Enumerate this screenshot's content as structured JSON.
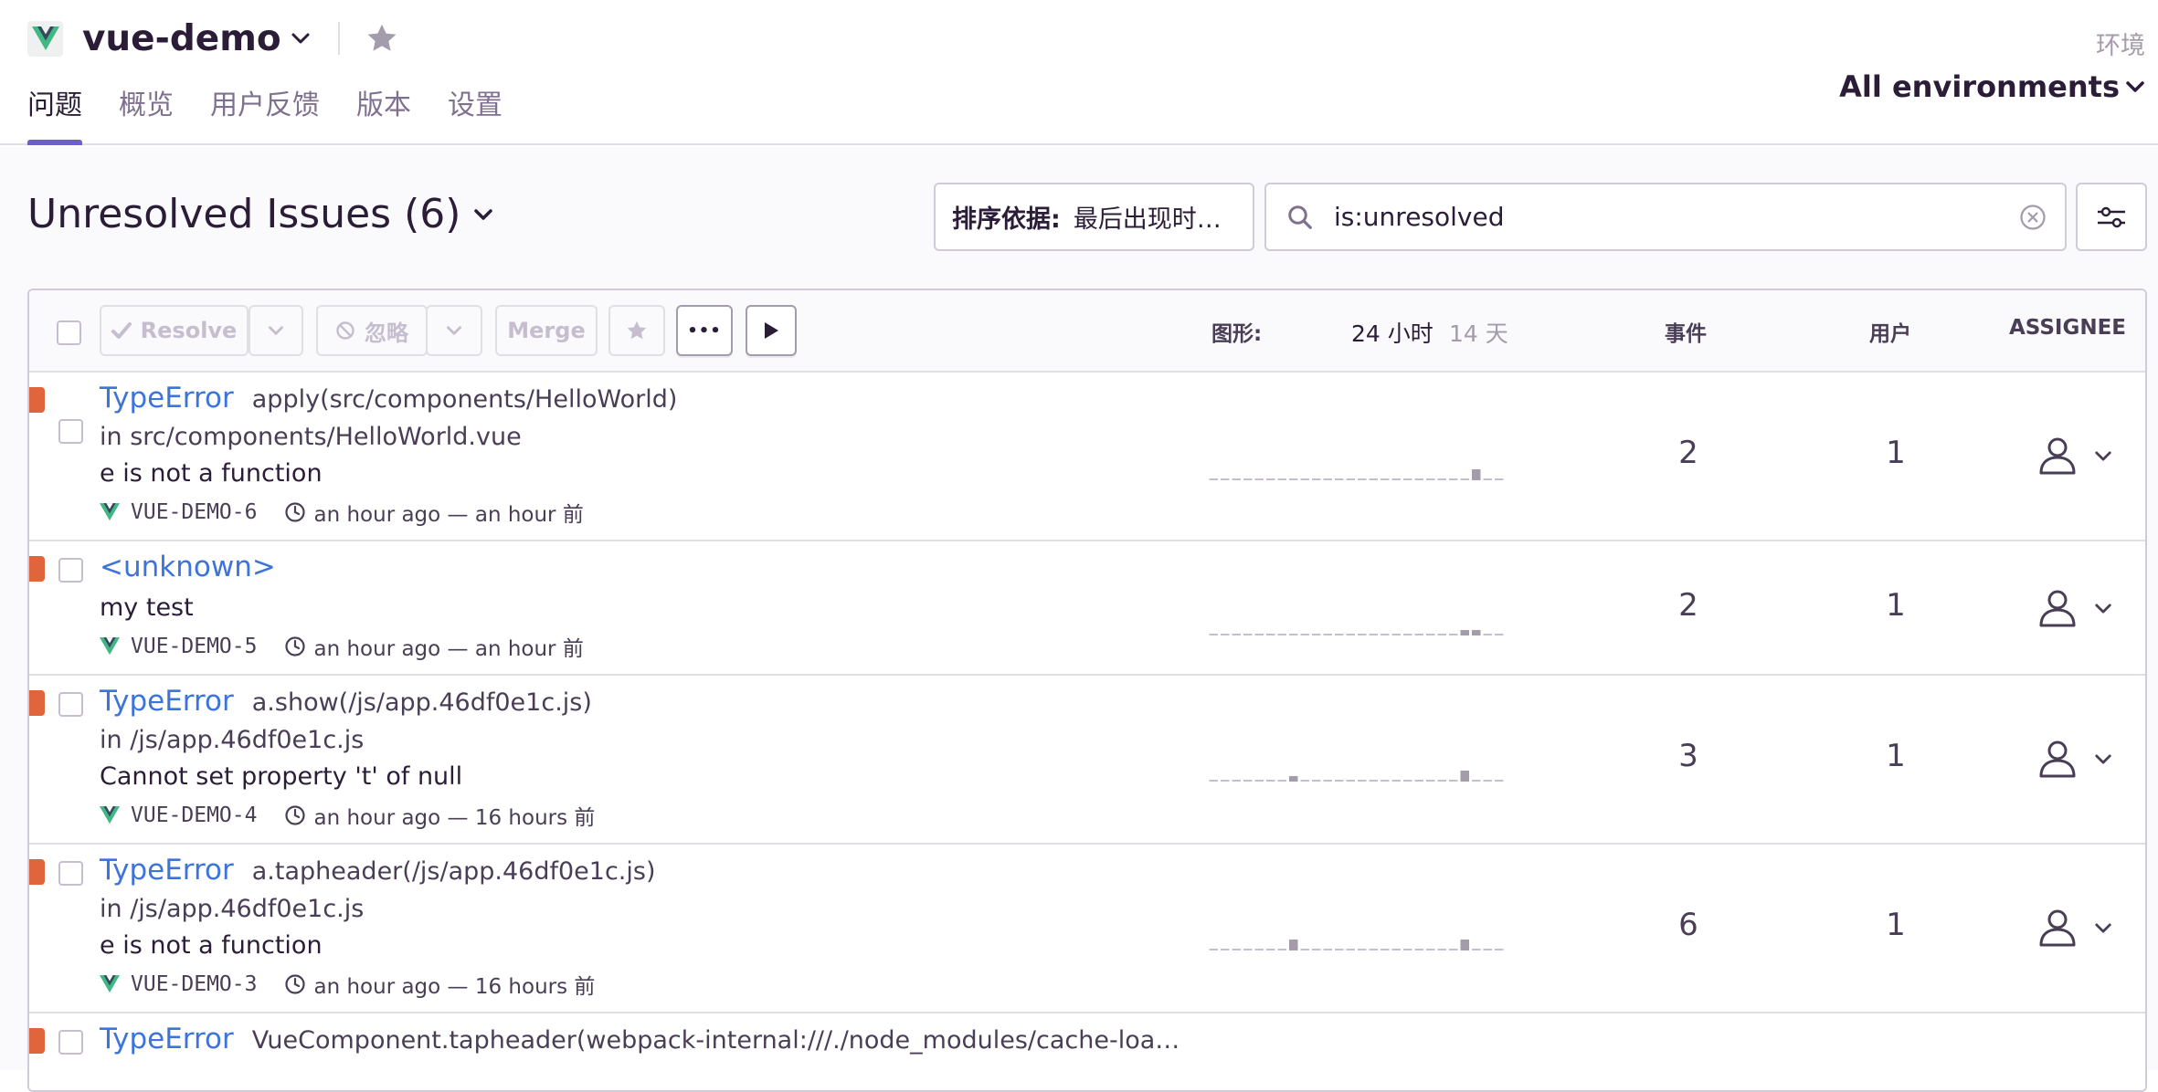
{
  "project": {
    "name": "vue-demo"
  },
  "tabs": [
    {
      "label": "问题",
      "active": true
    },
    {
      "label": "概览",
      "active": false
    },
    {
      "label": "用户反馈",
      "active": false
    },
    {
      "label": "版本",
      "active": false
    },
    {
      "label": "设置",
      "active": false
    }
  ],
  "environment": {
    "label": "环境",
    "value": "All environments"
  },
  "issues_header": {
    "title": "Unresolved Issues (6)"
  },
  "sort": {
    "label": "排序依据:",
    "value": "最后出现时…"
  },
  "search": {
    "query": "is:unresolved"
  },
  "toolbar": {
    "resolve_label": "Resolve",
    "ignore_label": "忽略",
    "merge_label": "Merge",
    "more_label": "•••",
    "graph_label": "图形:",
    "period_24h": "24 小时",
    "period_14d": "14 天",
    "col_events": "事件",
    "col_users": "用户",
    "col_assignee": "ASSIGNEE"
  },
  "colors": {
    "accent": "#6c5fc7",
    "link": "#3d74db",
    "level_error": "#e0653c",
    "border": "#d1cad8",
    "spark": "#c6becf"
  },
  "issues": [
    {
      "type": "TypeError",
      "location": "apply(src/components/HelloWorld)",
      "culprit": "in src/components/HelloWorld.vue",
      "message": "e is not a function",
      "short_id": "VUE-DEMO-6",
      "times": "an hour ago — an hour 前",
      "events": "2",
      "users": "1",
      "spark": [
        0,
        0,
        0,
        0,
        0,
        0,
        0,
        0,
        0,
        0,
        0,
        0,
        0,
        0,
        0,
        0,
        0,
        0,
        0,
        0,
        0,
        0,
        0,
        1,
        0,
        0
      ]
    },
    {
      "type": "<unknown>",
      "location": "",
      "culprit": "",
      "message": "my test",
      "short_id": "VUE-DEMO-5",
      "times": "an hour ago — an hour 前",
      "events": "2",
      "users": "1",
      "spark": [
        0,
        0,
        0,
        0,
        0,
        0,
        0,
        0,
        0,
        0,
        0,
        0,
        0,
        0,
        0,
        0,
        0,
        0,
        0,
        0,
        0,
        0,
        0.5,
        0.5,
        0,
        0
      ]
    },
    {
      "type": "TypeError",
      "location": "a.show(/js/app.46df0e1c.js)",
      "culprit": "in /js/app.46df0e1c.js",
      "message": "Cannot set property 't' of null",
      "short_id": "VUE-DEMO-4",
      "times": "an hour ago — 16 hours 前",
      "events": "3",
      "users": "1",
      "spark": [
        0,
        0,
        0,
        0,
        0,
        0,
        0,
        0.5,
        0,
        0,
        0,
        0,
        0,
        0,
        0,
        0,
        0,
        0,
        0,
        0,
        0,
        0,
        1,
        0,
        0,
        0
      ]
    },
    {
      "type": "TypeError",
      "location": "a.tapheader(/js/app.46df0e1c.js)",
      "culprit": "in /js/app.46df0e1c.js",
      "message": "e is not a function",
      "short_id": "VUE-DEMO-3",
      "times": "an hour ago — 16 hours 前",
      "events": "6",
      "users": "1",
      "spark": [
        0,
        0,
        0,
        0,
        0,
        0,
        0,
        1.5,
        0,
        0,
        0,
        0,
        0,
        0,
        0,
        0,
        0,
        0,
        0,
        0,
        0,
        0,
        1.5,
        0,
        0,
        0
      ]
    },
    {
      "type": "TypeError",
      "location": "VueComponent.tapheader(webpack-internal:///./node_modules/cache-loa…",
      "culprit": "",
      "message": "",
      "short_id": "",
      "times": "",
      "events": "",
      "users": "",
      "spark": []
    }
  ]
}
